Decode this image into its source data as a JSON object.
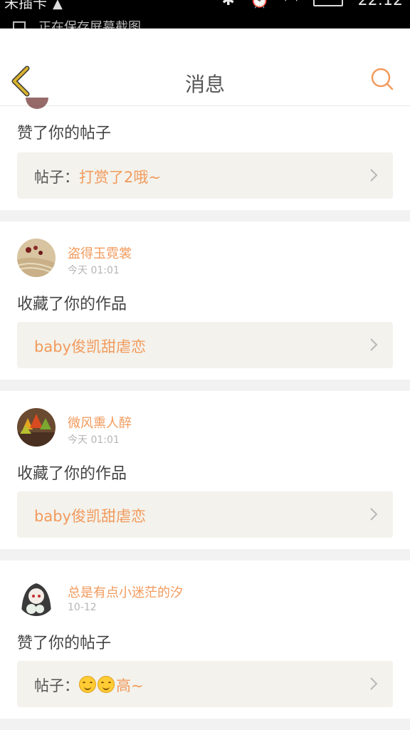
{
  "status_bar": {
    "carrier": "未插卡",
    "time": "22:12",
    "notification": "正在保存屏幕截图"
  },
  "header": {
    "title": "消息"
  },
  "colors": {
    "accent": "#f29a5c",
    "back_icon": "#c9a227",
    "ref_bg": "#f3f2ec"
  },
  "messages": [
    {
      "action": "赞了你的帖子",
      "ref_prefix": "帖子：",
      "ref_text": "打赏了2哦~"
    },
    {
      "user": "盗得玉霓裳",
      "time": "今天 01:01",
      "action": "收藏了你的作品",
      "ref_text": "baby俊凯甜虐恋"
    },
    {
      "user": "微风熏人醉",
      "time": "今天 01:01",
      "action": "收藏了你的作品",
      "ref_text": "baby俊凯甜虐恋"
    },
    {
      "user": "总是有点小迷茫的汐",
      "time": "10-12",
      "action": "赞了你的帖子",
      "ref_prefix": "帖子：",
      "ref_text": "高~",
      "ref_emoji_count": 2
    }
  ]
}
